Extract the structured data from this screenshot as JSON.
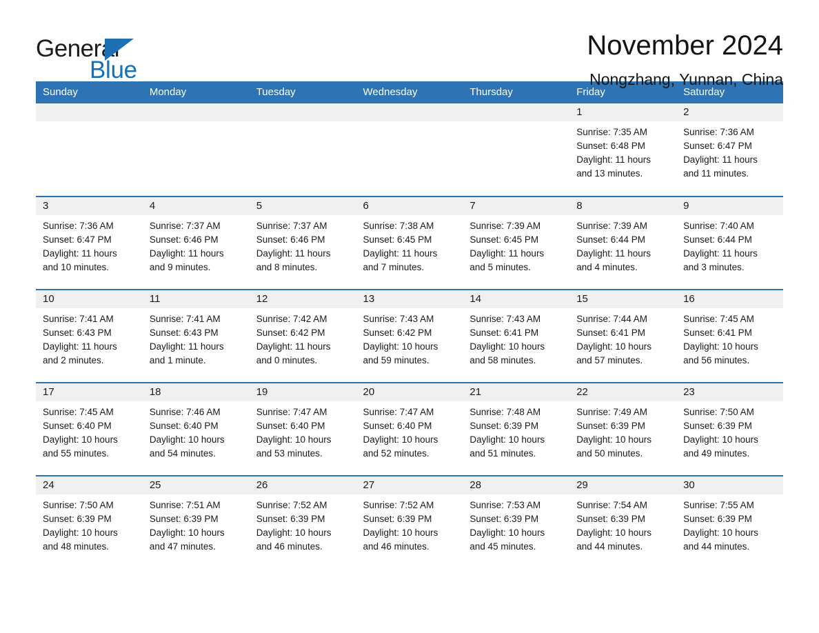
{
  "brand": {
    "name_part1": "General",
    "name_part2": "Blue",
    "logo_icon": "triangle-logo-icon",
    "accent_color": "#1270c0"
  },
  "header": {
    "title": "November 2024",
    "subtitle": "Nongzhang, Yunnan, China"
  },
  "calendar": {
    "header_bg": "#2e74b5",
    "daynum_bg": "#f0f0f0",
    "weekday_headers": [
      "Sunday",
      "Monday",
      "Tuesday",
      "Wednesday",
      "Thursday",
      "Friday",
      "Saturday"
    ],
    "weeks": [
      [
        {
          "day": "",
          "blank": true,
          "sunrise": "",
          "sunset": "",
          "daylight1": "",
          "daylight2": ""
        },
        {
          "day": "",
          "blank": true,
          "sunrise": "",
          "sunset": "",
          "daylight1": "",
          "daylight2": ""
        },
        {
          "day": "",
          "blank": true,
          "sunrise": "",
          "sunset": "",
          "daylight1": "",
          "daylight2": ""
        },
        {
          "day": "",
          "blank": true,
          "sunrise": "",
          "sunset": "",
          "daylight1": "",
          "daylight2": ""
        },
        {
          "day": "",
          "blank": true,
          "sunrise": "",
          "sunset": "",
          "daylight1": "",
          "daylight2": ""
        },
        {
          "day": "1",
          "blank": false,
          "sunrise": "Sunrise: 7:35 AM",
          "sunset": "Sunset: 6:48 PM",
          "daylight1": "Daylight: 11 hours",
          "daylight2": "and 13 minutes."
        },
        {
          "day": "2",
          "blank": false,
          "sunrise": "Sunrise: 7:36 AM",
          "sunset": "Sunset: 6:47 PM",
          "daylight1": "Daylight: 11 hours",
          "daylight2": "and 11 minutes."
        }
      ],
      [
        {
          "day": "3",
          "blank": false,
          "sunrise": "Sunrise: 7:36 AM",
          "sunset": "Sunset: 6:47 PM",
          "daylight1": "Daylight: 11 hours",
          "daylight2": "and 10 minutes."
        },
        {
          "day": "4",
          "blank": false,
          "sunrise": "Sunrise: 7:37 AM",
          "sunset": "Sunset: 6:46 PM",
          "daylight1": "Daylight: 11 hours",
          "daylight2": "and 9 minutes."
        },
        {
          "day": "5",
          "blank": false,
          "sunrise": "Sunrise: 7:37 AM",
          "sunset": "Sunset: 6:46 PM",
          "daylight1": "Daylight: 11 hours",
          "daylight2": "and 8 minutes."
        },
        {
          "day": "6",
          "blank": false,
          "sunrise": "Sunrise: 7:38 AM",
          "sunset": "Sunset: 6:45 PM",
          "daylight1": "Daylight: 11 hours",
          "daylight2": "and 7 minutes."
        },
        {
          "day": "7",
          "blank": false,
          "sunrise": "Sunrise: 7:39 AM",
          "sunset": "Sunset: 6:45 PM",
          "daylight1": "Daylight: 11 hours",
          "daylight2": "and 5 minutes."
        },
        {
          "day": "8",
          "blank": false,
          "sunrise": "Sunrise: 7:39 AM",
          "sunset": "Sunset: 6:44 PM",
          "daylight1": "Daylight: 11 hours",
          "daylight2": "and 4 minutes."
        },
        {
          "day": "9",
          "blank": false,
          "sunrise": "Sunrise: 7:40 AM",
          "sunset": "Sunset: 6:44 PM",
          "daylight1": "Daylight: 11 hours",
          "daylight2": "and 3 minutes."
        }
      ],
      [
        {
          "day": "10",
          "blank": false,
          "sunrise": "Sunrise: 7:41 AM",
          "sunset": "Sunset: 6:43 PM",
          "daylight1": "Daylight: 11 hours",
          "daylight2": "and 2 minutes."
        },
        {
          "day": "11",
          "blank": false,
          "sunrise": "Sunrise: 7:41 AM",
          "sunset": "Sunset: 6:43 PM",
          "daylight1": "Daylight: 11 hours",
          "daylight2": "and 1 minute."
        },
        {
          "day": "12",
          "blank": false,
          "sunrise": "Sunrise: 7:42 AM",
          "sunset": "Sunset: 6:42 PM",
          "daylight1": "Daylight: 11 hours",
          "daylight2": "and 0 minutes."
        },
        {
          "day": "13",
          "blank": false,
          "sunrise": "Sunrise: 7:43 AM",
          "sunset": "Sunset: 6:42 PM",
          "daylight1": "Daylight: 10 hours",
          "daylight2": "and 59 minutes."
        },
        {
          "day": "14",
          "blank": false,
          "sunrise": "Sunrise: 7:43 AM",
          "sunset": "Sunset: 6:41 PM",
          "daylight1": "Daylight: 10 hours",
          "daylight2": "and 58 minutes."
        },
        {
          "day": "15",
          "blank": false,
          "sunrise": "Sunrise: 7:44 AM",
          "sunset": "Sunset: 6:41 PM",
          "daylight1": "Daylight: 10 hours",
          "daylight2": "and 57 minutes."
        },
        {
          "day": "16",
          "blank": false,
          "sunrise": "Sunrise: 7:45 AM",
          "sunset": "Sunset: 6:41 PM",
          "daylight1": "Daylight: 10 hours",
          "daylight2": "and 56 minutes."
        }
      ],
      [
        {
          "day": "17",
          "blank": false,
          "sunrise": "Sunrise: 7:45 AM",
          "sunset": "Sunset: 6:40 PM",
          "daylight1": "Daylight: 10 hours",
          "daylight2": "and 55 minutes."
        },
        {
          "day": "18",
          "blank": false,
          "sunrise": "Sunrise: 7:46 AM",
          "sunset": "Sunset: 6:40 PM",
          "daylight1": "Daylight: 10 hours",
          "daylight2": "and 54 minutes."
        },
        {
          "day": "19",
          "blank": false,
          "sunrise": "Sunrise: 7:47 AM",
          "sunset": "Sunset: 6:40 PM",
          "daylight1": "Daylight: 10 hours",
          "daylight2": "and 53 minutes."
        },
        {
          "day": "20",
          "blank": false,
          "sunrise": "Sunrise: 7:47 AM",
          "sunset": "Sunset: 6:40 PM",
          "daylight1": "Daylight: 10 hours",
          "daylight2": "and 52 minutes."
        },
        {
          "day": "21",
          "blank": false,
          "sunrise": "Sunrise: 7:48 AM",
          "sunset": "Sunset: 6:39 PM",
          "daylight1": "Daylight: 10 hours",
          "daylight2": "and 51 minutes."
        },
        {
          "day": "22",
          "blank": false,
          "sunrise": "Sunrise: 7:49 AM",
          "sunset": "Sunset: 6:39 PM",
          "daylight1": "Daylight: 10 hours",
          "daylight2": "and 50 minutes."
        },
        {
          "day": "23",
          "blank": false,
          "sunrise": "Sunrise: 7:50 AM",
          "sunset": "Sunset: 6:39 PM",
          "daylight1": "Daylight: 10 hours",
          "daylight2": "and 49 minutes."
        }
      ],
      [
        {
          "day": "24",
          "blank": false,
          "sunrise": "Sunrise: 7:50 AM",
          "sunset": "Sunset: 6:39 PM",
          "daylight1": "Daylight: 10 hours",
          "daylight2": "and 48 minutes."
        },
        {
          "day": "25",
          "blank": false,
          "sunrise": "Sunrise: 7:51 AM",
          "sunset": "Sunset: 6:39 PM",
          "daylight1": "Daylight: 10 hours",
          "daylight2": "and 47 minutes."
        },
        {
          "day": "26",
          "blank": false,
          "sunrise": "Sunrise: 7:52 AM",
          "sunset": "Sunset: 6:39 PM",
          "daylight1": "Daylight: 10 hours",
          "daylight2": "and 46 minutes."
        },
        {
          "day": "27",
          "blank": false,
          "sunrise": "Sunrise: 7:52 AM",
          "sunset": "Sunset: 6:39 PM",
          "daylight1": "Daylight: 10 hours",
          "daylight2": "and 46 minutes."
        },
        {
          "day": "28",
          "blank": false,
          "sunrise": "Sunrise: 7:53 AM",
          "sunset": "Sunset: 6:39 PM",
          "daylight1": "Daylight: 10 hours",
          "daylight2": "and 45 minutes."
        },
        {
          "day": "29",
          "blank": false,
          "sunrise": "Sunrise: 7:54 AM",
          "sunset": "Sunset: 6:39 PM",
          "daylight1": "Daylight: 10 hours",
          "daylight2": "and 44 minutes."
        },
        {
          "day": "30",
          "blank": false,
          "sunrise": "Sunrise: 7:55 AM",
          "sunset": "Sunset: 6:39 PM",
          "daylight1": "Daylight: 10 hours",
          "daylight2": "and 44 minutes."
        }
      ]
    ]
  }
}
